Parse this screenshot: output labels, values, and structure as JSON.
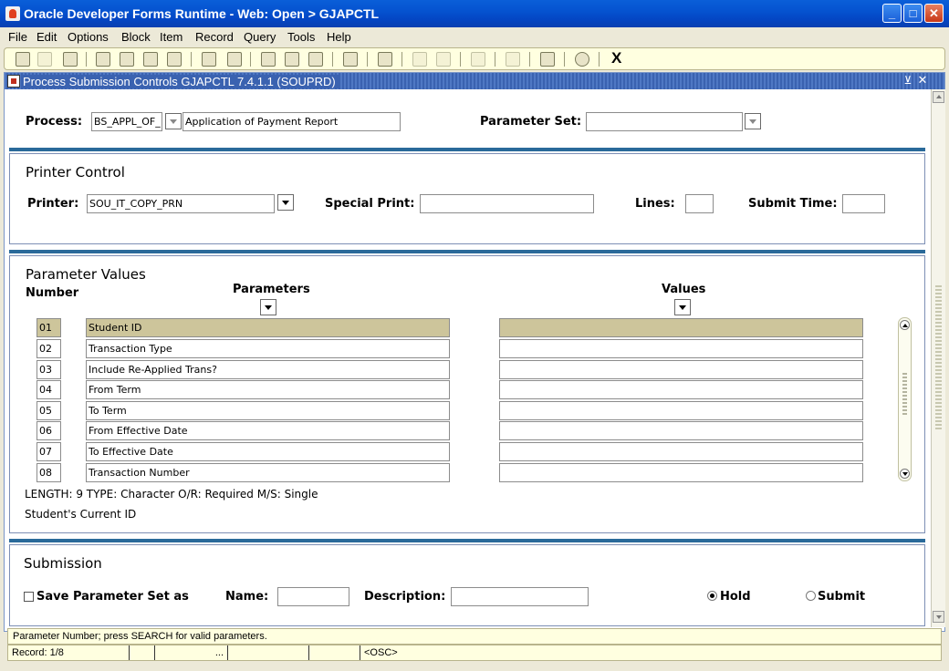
{
  "window": {
    "title": "Oracle Developer Forms Runtime - Web:  Open > GJAPCTL",
    "minimize": "_",
    "maximize": "□",
    "close": "✕"
  },
  "menu": [
    "File",
    "Edit",
    "Options",
    "Block",
    "Item",
    "Record",
    "Query",
    "Tools",
    "Help"
  ],
  "toolbar": {
    "icons": [
      "save-icon",
      "rollback-icon",
      "print-icon",
      "insert-record-icon",
      "remove-record-icon",
      "previous-block-icon",
      "next-block-icon",
      "enter-query-icon",
      "execute-query-icon",
      "help-icon",
      "database-icon",
      "exit-record-icon",
      "copy-icon",
      "printer-icon",
      "item-icon",
      "block-icon",
      "audio-icon",
      "target-icon",
      "navigate-icon",
      "question-icon"
    ],
    "exit_label": "X"
  },
  "form": {
    "title": "Process Submission Controls  GJAPCTL  7.4.1.1  (SOUPRD)",
    "process_label": "Process:",
    "process_code": "BS_APPL_OF_",
    "process_desc": "Application of Payment Report",
    "param_set_label": "Parameter Set:",
    "param_set_value": ""
  },
  "printer_control": {
    "heading": "Printer Control",
    "printer_label": "Printer:",
    "printer_value": "SOU_IT_COPY_PRN",
    "special_print_label": "Special Print:",
    "special_print_value": "",
    "lines_label": "Lines:",
    "lines_value": "",
    "submit_time_label": "Submit Time:",
    "submit_time_value": ""
  },
  "parameter_values": {
    "heading": "Parameter Values",
    "number_header": "Number",
    "parameters_header": "Parameters",
    "values_header": "Values",
    "rows": [
      {
        "number": "01",
        "parameter": "Student ID",
        "value": ""
      },
      {
        "number": "02",
        "parameter": "Transaction Type",
        "value": ""
      },
      {
        "number": "03",
        "parameter": "Include Re-Applied Trans?",
        "value": ""
      },
      {
        "number": "04",
        "parameter": "From Term",
        "value": ""
      },
      {
        "number": "05",
        "parameter": "To Term",
        "value": ""
      },
      {
        "number": "06",
        "parameter": "From Effective Date",
        "value": ""
      },
      {
        "number": "07",
        "parameter": "To Effective Date",
        "value": ""
      },
      {
        "number": "08",
        "parameter": "Transaction Number",
        "value": ""
      }
    ],
    "info_line": "LENGTH: 9 TYPE: Character O/R: Required M/S: Single",
    "description": "Student's Current ID"
  },
  "submission": {
    "heading": "Submission",
    "save_label": "Save Parameter Set as",
    "name_label": "Name:",
    "name_value": "",
    "description_label": "Description:",
    "description_value": "",
    "hold_label": "Hold",
    "submit_label": "Submit",
    "selected": "Hold"
  },
  "hint": "Parameter Number; press SEARCH for valid parameters.",
  "status": {
    "record": "Record: 1/8",
    "seg2": "",
    "seg3": "...",
    "seg4": "",
    "seg5": "",
    "osc": "<OSC>"
  }
}
